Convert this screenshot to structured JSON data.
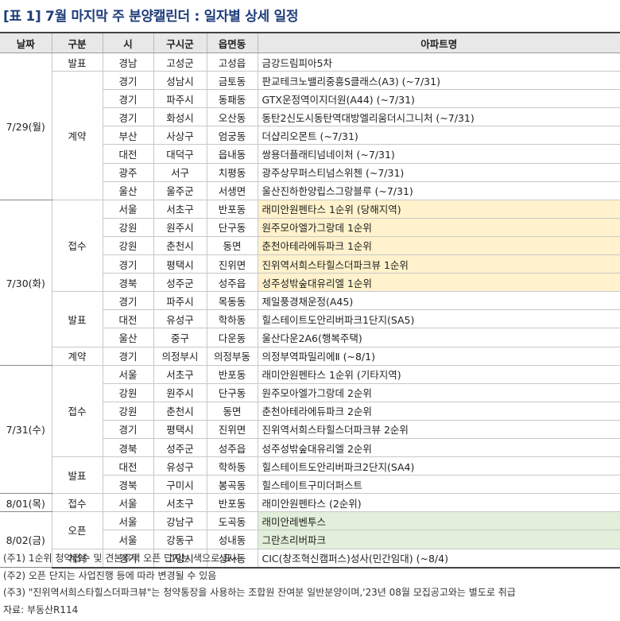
{
  "title": "[표 1] 7월 마지막 주 분양캘린더 : 일자별 상세 일정",
  "columns": [
    "날짜",
    "구분",
    "시",
    "구시군",
    "읍면동",
    "아파트명"
  ],
  "groups": [
    {
      "date": "7/29(월)",
      "types": [
        {
          "type": "발표",
          "rows": [
            {
              "si": "경남",
              "gu": "고성군",
              "dong": "고성읍",
              "apt": "금강드림피아5차",
              "hl": ""
            }
          ]
        },
        {
          "type": "계약",
          "rows": [
            {
              "si": "경기",
              "gu": "성남시",
              "dong": "금토동",
              "apt": "판교테크노밸리중흥S클래스(A3) (~7/31)",
              "hl": ""
            },
            {
              "si": "경기",
              "gu": "파주시",
              "dong": "동패동",
              "apt": "GTX운정역이지더원(A44) (~7/31)",
              "hl": ""
            },
            {
              "si": "경기",
              "gu": "화성시",
              "dong": "오산동",
              "apt": "동탄2신도시동탄역대방엘리움더시그니처 (~7/31)",
              "hl": ""
            },
            {
              "si": "부산",
              "gu": "사상구",
              "dong": "엄궁동",
              "apt": "더샵리오몬트 (~7/31)",
              "hl": ""
            },
            {
              "si": "대전",
              "gu": "대덕구",
              "dong": "읍내동",
              "apt": "쌍용더플래티넘네이처 (~7/31)",
              "hl": ""
            },
            {
              "si": "광주",
              "gu": "서구",
              "dong": "치평동",
              "apt": "광주상무퍼스티넘스위첸 (~7/31)",
              "hl": ""
            },
            {
              "si": "울산",
              "gu": "울주군",
              "dong": "서생면",
              "apt": "울산진하한양립스그랑블루 (~7/31)",
              "hl": ""
            }
          ]
        }
      ]
    },
    {
      "date": "7/30(화)",
      "types": [
        {
          "type": "접수",
          "rows": [
            {
              "si": "서울",
              "gu": "서초구",
              "dong": "반포동",
              "apt": "래미안원펜타스 1순위 (당해지역)",
              "hl": "yellow"
            },
            {
              "si": "강원",
              "gu": "원주시",
              "dong": "단구동",
              "apt": "원주모아엘가그랑데 1순위",
              "hl": "yellow"
            },
            {
              "si": "강원",
              "gu": "춘천시",
              "dong": "동면",
              "apt": "춘천아테라에듀파크 1순위",
              "hl": "yellow"
            },
            {
              "si": "경기",
              "gu": "평택시",
              "dong": "진위면",
              "apt": "진위역서희스타힐스더파크뷰 1순위",
              "hl": "yellow"
            },
            {
              "si": "경북",
              "gu": "성주군",
              "dong": "성주읍",
              "apt": "성주성밖숲대유리엘 1순위",
              "hl": "yellow"
            }
          ]
        },
        {
          "type": "발표",
          "rows": [
            {
              "si": "경기",
              "gu": "파주시",
              "dong": "목동동",
              "apt": "제일풍경채운정(A45)",
              "hl": ""
            },
            {
              "si": "대전",
              "gu": "유성구",
              "dong": "학하동",
              "apt": "힐스테이트도안리버파크1단지(SA5)",
              "hl": ""
            },
            {
              "si": "울산",
              "gu": "중구",
              "dong": "다운동",
              "apt": "울산다운2A6(행복주택)",
              "hl": ""
            }
          ]
        },
        {
          "type": "계약",
          "rows": [
            {
              "si": "경기",
              "gu": "의정부시",
              "dong": "의정부동",
              "apt": "의정부역파밀리에Ⅱ (~8/1)",
              "hl": ""
            }
          ]
        }
      ]
    },
    {
      "date": "7/31(수)",
      "types": [
        {
          "type": "접수",
          "rows": [
            {
              "si": "서울",
              "gu": "서초구",
              "dong": "반포동",
              "apt": "래미안원펜타스 1순위 (기타지역)",
              "hl": ""
            },
            {
              "si": "강원",
              "gu": "원주시",
              "dong": "단구동",
              "apt": "원주모아엘가그랑데 2순위",
              "hl": ""
            },
            {
              "si": "강원",
              "gu": "춘천시",
              "dong": "동면",
              "apt": "춘천아테라에듀파크 2순위",
              "hl": ""
            },
            {
              "si": "경기",
              "gu": "평택시",
              "dong": "진위면",
              "apt": "진위역서희스타힐스더파크뷰 2순위",
              "hl": ""
            },
            {
              "si": "경북",
              "gu": "성주군",
              "dong": "성주읍",
              "apt": "성주성밖숲대유리엘 2순위",
              "hl": ""
            }
          ]
        },
        {
          "type": "발표",
          "rows": [
            {
              "si": "대전",
              "gu": "유성구",
              "dong": "학하동",
              "apt": "힐스테이트도안리버파크2단지(SA4)",
              "hl": ""
            },
            {
              "si": "경북",
              "gu": "구미시",
              "dong": "봉곡동",
              "apt": "힐스테이트구미더퍼스트",
              "hl": ""
            }
          ]
        }
      ]
    },
    {
      "date": "8/01(목)",
      "types": [
        {
          "type": "접수",
          "rows": [
            {
              "si": "서울",
              "gu": "서초구",
              "dong": "반포동",
              "apt": "래미안원펜타스 (2순위)",
              "hl": ""
            }
          ]
        }
      ]
    },
    {
      "date": "8/02(금)",
      "types": [
        {
          "type": "오픈",
          "rows": [
            {
              "si": "서울",
              "gu": "강남구",
              "dong": "도곡동",
              "apt": "래미안레벤투스",
              "hl": "green"
            },
            {
              "si": "서울",
              "gu": "강동구",
              "dong": "성내동",
              "apt": "그란츠리버파크",
              "hl": "green"
            }
          ]
        },
        {
          "type": "계약",
          "rows": [
            {
              "si": "경기",
              "gu": "고양시",
              "dong": "성사동",
              "apt": "CIC(창조혁신캠퍼스)성사(민간임대) (~8/4)",
              "hl": ""
            }
          ]
        }
      ]
    }
  ],
  "notes": [
    "(주1) 1순위 청약접수 및 견본주택 오픈 단지는 색으로 표시",
    "(주2) 오픈 단지는 사업진행 등에 따라 변경될 수 있음",
    "(주3) \"진위역서희스타힐스더파크뷰\"는 청약통장을 사용하는 조합원 잔여분 일반분양이며,'23년 08월 모집공고와는 별도로 취급",
    "자료: 부동산R114"
  ],
  "colors": {
    "title": "#1f3d7a",
    "highlight_yellow": "#fff2cc",
    "highlight_green": "#e2efda",
    "header_bg": "#e8e8e8"
  }
}
